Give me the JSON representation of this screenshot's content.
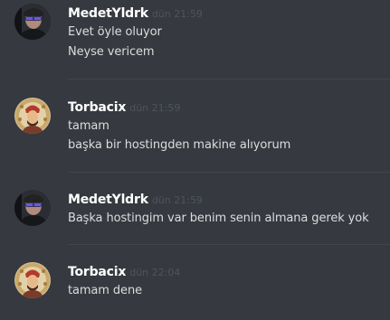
{
  "messages": [
    {
      "author": "MedetYldrk",
      "timestamp": "dün 21:59",
      "avatar": "user-avatar-medet",
      "lines": [
        "Evet öyle oluyor",
        "Neyse vericem"
      ]
    },
    {
      "author": "Torbacix",
      "timestamp": "dün 21:59",
      "avatar": "user-avatar-torbacix",
      "lines": [
        "tamam",
        "başka bir hostingden makine alıyorum"
      ]
    },
    {
      "author": "MedetYldrk",
      "timestamp": "dün 21:59",
      "avatar": "user-avatar-medet",
      "lines": [
        "Başka hostingim var benim senin almana gerek yok"
      ]
    },
    {
      "author": "Torbacix",
      "timestamp": "dün 22:04",
      "avatar": "user-avatar-torbacix",
      "lines": [
        "tamam dene"
      ]
    }
  ],
  "colors": {
    "background": "#36393f",
    "username": "#ffffff",
    "text": "#dcddde",
    "timestamp": "#4f545c",
    "divider": "#42454a"
  }
}
